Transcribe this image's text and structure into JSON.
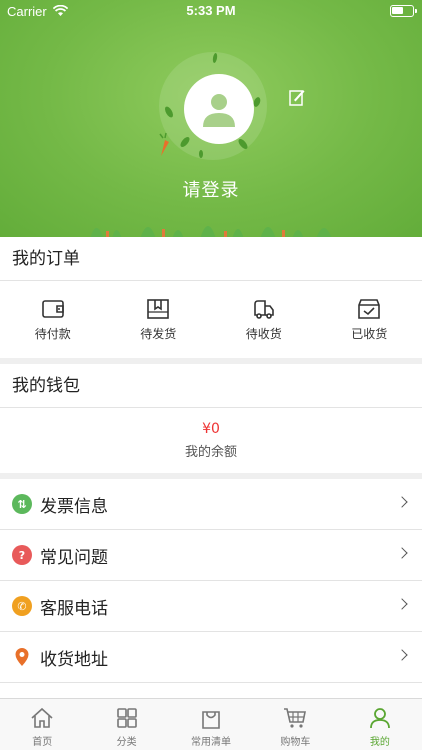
{
  "status_bar": {
    "carrier": "Carrier",
    "time": "5:33 PM"
  },
  "header": {
    "login_text": "请登录"
  },
  "orders": {
    "title": "我的订单",
    "items": [
      {
        "label": "待付款",
        "icon": "wallet-icon"
      },
      {
        "label": "待发货",
        "icon": "package-icon"
      },
      {
        "label": "待收货",
        "icon": "truck-icon"
      },
      {
        "label": "已收货",
        "icon": "received-box-icon"
      }
    ]
  },
  "wallet": {
    "title": "我的钱包",
    "amount": "¥0",
    "label": "我的余额"
  },
  "menu": {
    "items": [
      {
        "label": "发票信息",
        "icon": "invoice-icon",
        "color": "#5cb85c"
      },
      {
        "label": "常见问题",
        "icon": "question-icon",
        "color": "#e85a5a"
      },
      {
        "label": "客服电话",
        "icon": "phone-icon",
        "color": "#f0a020"
      },
      {
        "label": "收货地址",
        "icon": "location-icon",
        "color": "#e8702a"
      }
    ]
  },
  "tabbar": {
    "items": [
      {
        "label": "首页",
        "icon": "home-icon",
        "active": false
      },
      {
        "label": "分类",
        "icon": "category-icon",
        "active": false
      },
      {
        "label": "常用清单",
        "icon": "shopping-bag-icon",
        "active": false
      },
      {
        "label": "购物车",
        "icon": "cart-icon",
        "active": false
      },
      {
        "label": "我的",
        "icon": "profile-icon",
        "active": true
      }
    ]
  },
  "colors": {
    "brand_green": "#74b947",
    "active_tab": "#5aa632",
    "price_red": "#e33333"
  }
}
